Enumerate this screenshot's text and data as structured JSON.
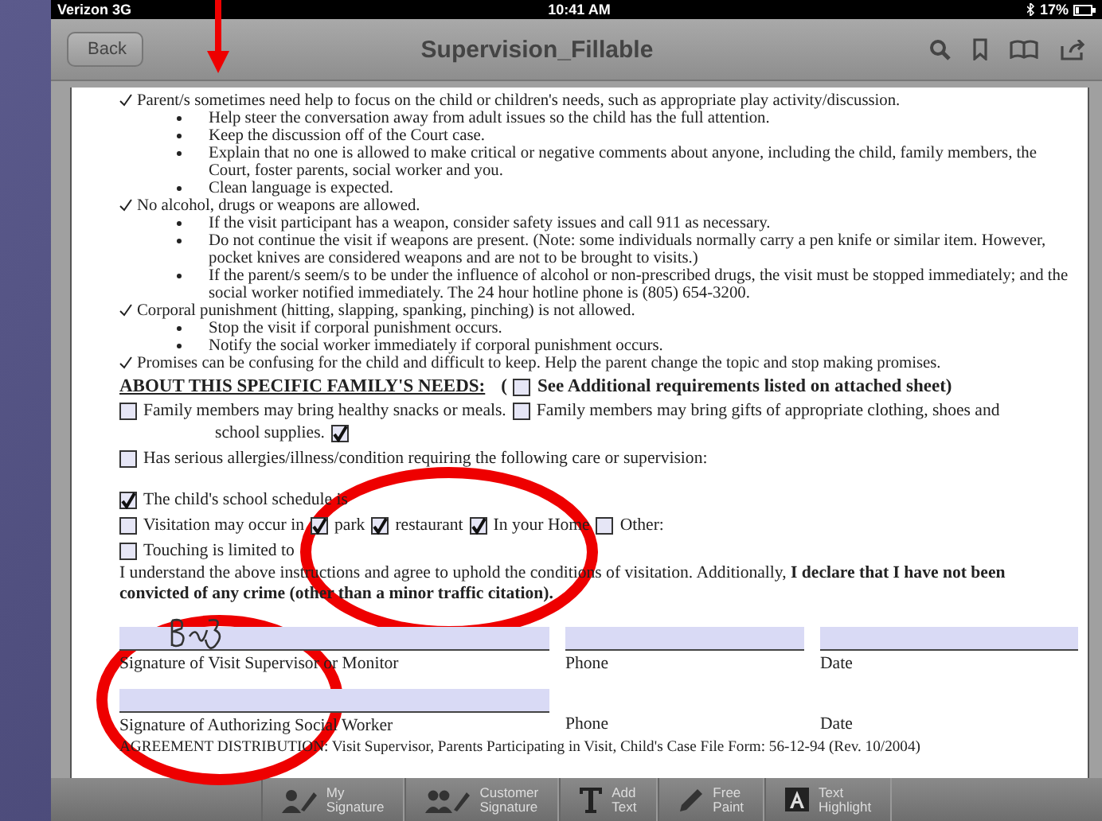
{
  "status_bar": {
    "carrier": "Verizon 3G",
    "time": "10:41 AM",
    "battery": "17%"
  },
  "nav_bar": {
    "back": "Back",
    "title": "Supervision_Fillable"
  },
  "document": {
    "lines": [
      {
        "kind": "tick",
        "text": "Parent/s sometimes need help to focus on the child or children's needs, such as appropriate play activity/discussion."
      },
      {
        "kind": "bullet",
        "text": "Help steer the conversation away from adult issues so the child has the full attention."
      },
      {
        "kind": "bullet",
        "text": "Keep the discussion off of the Court case."
      },
      {
        "kind": "bullet",
        "text": "Explain that no one is allowed to make critical or negative comments about anyone, including the child, family members, the Court, foster parents, social worker and you."
      },
      {
        "kind": "bullet",
        "text": "Clean language is expected."
      },
      {
        "kind": "tick",
        "text": "No alcohol, drugs or weapons are allowed."
      },
      {
        "kind": "bullet",
        "text": "If the visit participant has a weapon, consider safety issues and call 911 as necessary."
      },
      {
        "kind": "bullet",
        "text": "Do not continue the visit if weapons are present. (Note: some individuals normally carry a pen knife or similar item. However, pocket knives are considered weapons and are not to be brought to visits.)"
      },
      {
        "kind": "bullet",
        "text": "If the parent/s seem/s to be under the influence of alcohol or non-prescribed drugs, the visit must be stopped immediately; and the social worker notified immediately. The 24 hour hotline phone is (805) 654-3200."
      },
      {
        "kind": "tick",
        "text": "Corporal punishment (hitting, slapping, spanking, pinching) is not allowed."
      },
      {
        "kind": "bullet",
        "text": "Stop the visit if corporal punishment occurs."
      },
      {
        "kind": "bullet",
        "text": "Notify the social worker immediately if corporal punishment occurs."
      },
      {
        "kind": "tick",
        "text": "Promises can be confusing for the child and difficult to keep. Help the parent change the topic and stop making promises."
      }
    ],
    "heading": {
      "title": "ABOUT THIS SPECIFIC FAMILY'S NEEDS:",
      "open": "(",
      "checked": false,
      "note": "See Additional requirements listed on attached sheet)"
    },
    "form_rows": [
      {
        "kind": "options",
        "items": [
          {
            "kind": "checkbox",
            "checked": false
          },
          {
            "kind": "text",
            "text": "Family members may bring healthy snacks or meals."
          },
          {
            "kind": "checkbox",
            "checked": false
          },
          {
            "kind": "text",
            "text": "Family members may bring gifts of appropriate clothing, shoes and"
          }
        ]
      },
      {
        "kind": "continuation",
        "items": [
          {
            "kind": "text",
            "text": "school supplies."
          },
          {
            "kind": "checkbox",
            "checked": true
          }
        ]
      },
      {
        "kind": "options",
        "items": [
          {
            "kind": "checkbox",
            "checked": false
          },
          {
            "kind": "text",
            "text": "Has serious allergies/illness/condition requiring the following care or supervision:"
          }
        ]
      },
      {
        "kind": "options",
        "items": [
          {
            "kind": "checkbox",
            "checked": true
          },
          {
            "kind": "text",
            "text": "The child's school schedule is"
          }
        ]
      },
      {
        "kind": "options",
        "items": [
          {
            "kind": "checkbox",
            "checked": false
          },
          {
            "kind": "text",
            "text": "Visitation may occur in"
          },
          {
            "kind": "checkbox",
            "checked": true
          },
          {
            "kind": "text",
            "text": "park"
          },
          {
            "kind": "checkbox",
            "checked": true
          },
          {
            "kind": "text",
            "text": "restaurant"
          },
          {
            "kind": "checkbox",
            "checked": true
          },
          {
            "kind": "text",
            "text": "In your Home"
          },
          {
            "kind": "checkbox",
            "checked": false
          },
          {
            "kind": "text",
            "text": "Other:"
          }
        ]
      },
      {
        "kind": "options",
        "items": [
          {
            "kind": "checkbox",
            "checked": false
          },
          {
            "kind": "text",
            "text": "Touching is limited to"
          }
        ]
      }
    ],
    "declaration": "I understand the above instructions and agree to uphold the conditions of visitation. Additionally, **I declare that I have not been convicted of any crime (other than a minor traffic citation).**",
    "signature_rows": [
      [
        {
          "label": "Signature of Visit Supervisor or Monitor",
          "field": true,
          "signed": true
        },
        {
          "label": "Phone",
          "field": true
        },
        {
          "label": "Date",
          "field": true
        }
      ],
      [
        {
          "label": "Signature of Authorizing Social Worker",
          "field": true
        },
        {
          "label": "Phone",
          "field": false
        },
        {
          "label": "Date",
          "field": false
        }
      ]
    ],
    "footer": "AGREEMENT DISTRIBUTION: Visit Supervisor, Parents Participating in Visit, Child's Case File  Form: 56-12-94 (Rev. 10/2004)"
  },
  "toolbar": [
    {
      "kind": "signature",
      "label": "My Signature"
    },
    {
      "kind": "customer",
      "label": "Customer Signature"
    },
    {
      "kind": "text",
      "label": "Add Text"
    },
    {
      "kind": "paint",
      "label": "Free Paint"
    },
    {
      "kind": "highlight",
      "label": "Text Highlight"
    }
  ]
}
